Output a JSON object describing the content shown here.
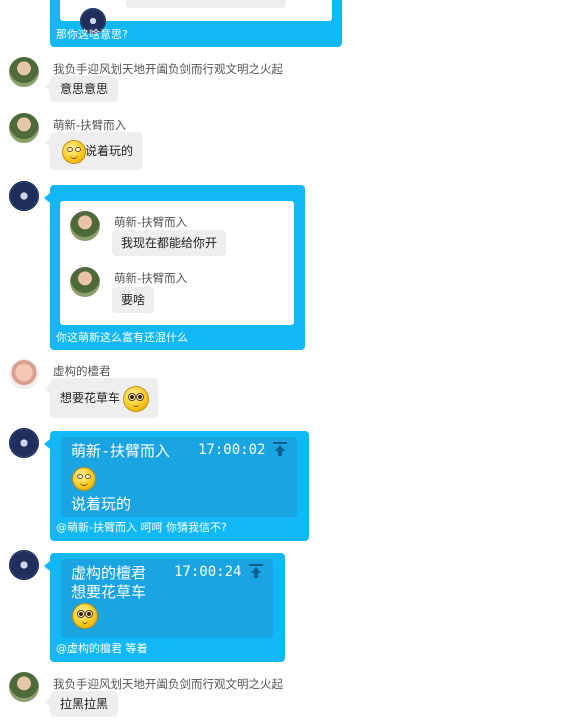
{
  "messages": {
    "m0_footer": "那你这啥意思?",
    "m1_name": "我负手迎风划天地开阖负剑而行观文明之火起",
    "m1_text": "意思意思",
    "m2_name": "萌新-扶臂而入",
    "m2_text": "说着玩的",
    "m3_quotes": [
      {
        "name": "萌新-扶臂而入",
        "text": "我现在都能给你开"
      },
      {
        "name": "萌新-扶臂而入",
        "text": "要啥"
      }
    ],
    "m3_footer": "你这萌新这么富有还混什么",
    "m4_name": "虚构的檀君",
    "m4_text": "想要花草车",
    "m5_quote_name": "萌新-扶臂而入",
    "m5_quote_time": "17:00:02",
    "m5_quote_text": "说着玩的",
    "m5_footer": "@萌新-扶臂而入 呵呵 你猜我信不?",
    "m6_quote_name": "虚构的檀君",
    "m6_quote_time": "17:00:24",
    "m6_quote_text": "想要花草车",
    "m6_footer": "@虚构的檀君 等着",
    "m7_name": "我负手迎风划天地开阖负剑而行观文明之火起",
    "m7_text": "拉黑拉黑"
  },
  "colors": {
    "accent": "#12b7f5",
    "quote_bg": "#1aa4e2",
    "bubble_gray": "#eeeeee"
  },
  "icons": [
    "smile-emoji-icon",
    "pleading-emoji-icon",
    "pin-top-icon"
  ]
}
